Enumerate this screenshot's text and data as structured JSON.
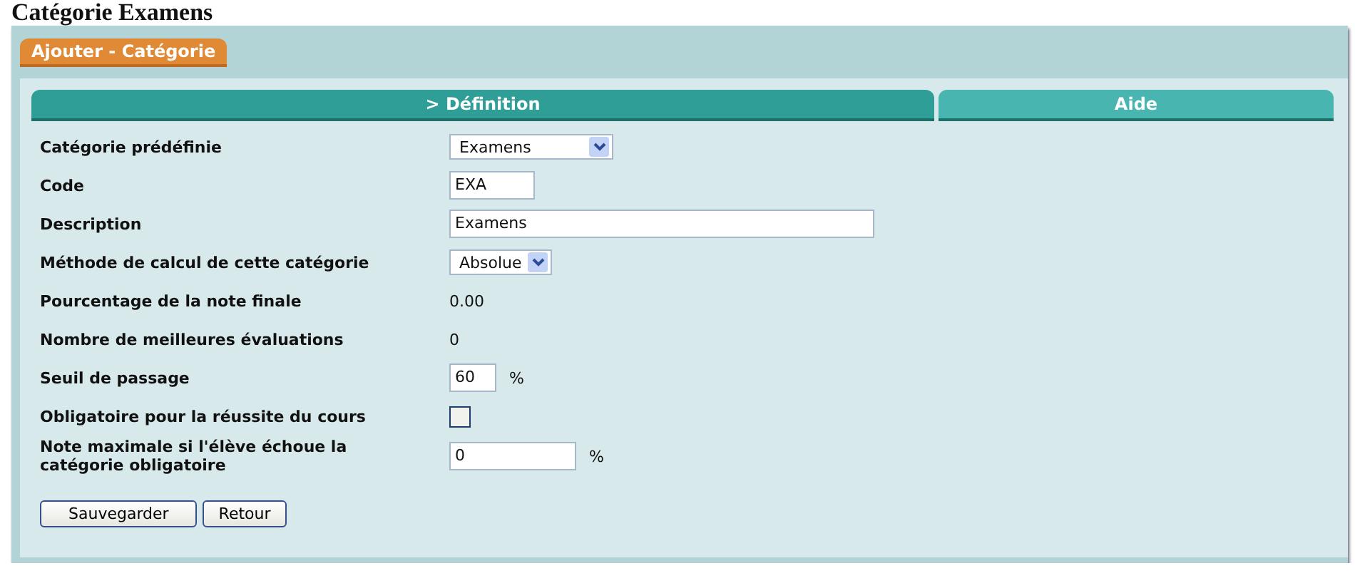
{
  "heading": "Catégorie Examens",
  "panel_tab": "Ajouter - Catégorie",
  "tabs": [
    {
      "label": "> Définition",
      "selected": true
    },
    {
      "label": "Aide",
      "selected": false
    }
  ],
  "fields": [
    {
      "kind": "select",
      "label": "Catégorie prédéfinie",
      "value": "Examens"
    },
    {
      "kind": "text",
      "label": "Code",
      "value": "EXA"
    },
    {
      "kind": "text",
      "label": "Description",
      "value": "Examens"
    },
    {
      "kind": "select",
      "label": "Méthode de calcul de cette catégorie",
      "value": "Absolue"
    },
    {
      "kind": "static",
      "label": "Pourcentage de la note finale",
      "value": "0.00"
    },
    {
      "kind": "static",
      "label": "Nombre de meilleures évaluations",
      "value": "0"
    },
    {
      "kind": "text",
      "label": "Seuil de passage",
      "value": "60",
      "unit": "%"
    },
    {
      "kind": "checkbox",
      "label": "Obligatoire pour la réussite du cours",
      "checked": false
    },
    {
      "kind": "text",
      "label": "Note maximale si l'élève échoue la catégorie obligatoire",
      "value": "0",
      "unit": "%"
    }
  ],
  "buttons": [
    "Sauvegarder",
    "Retour"
  ]
}
